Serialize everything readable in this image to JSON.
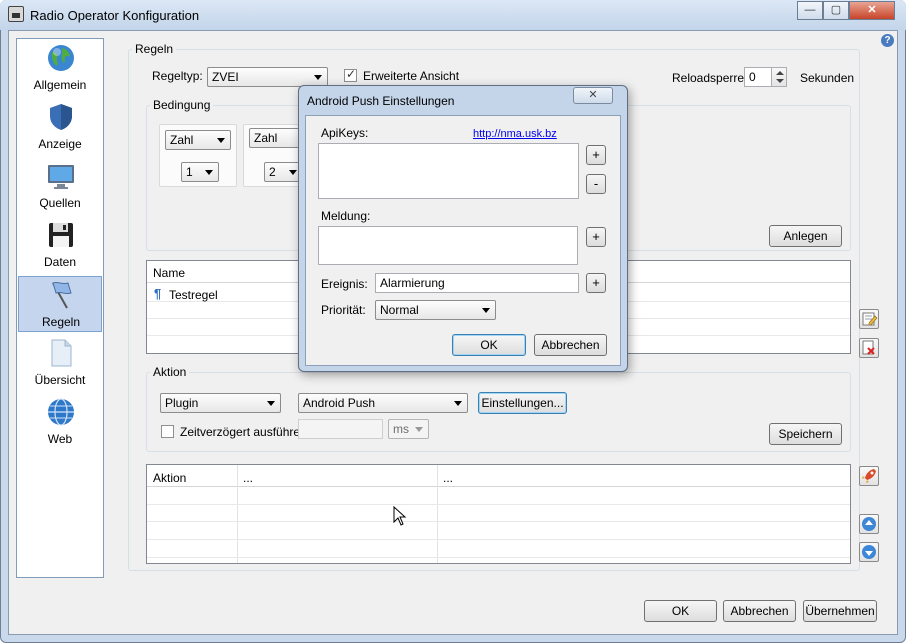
{
  "window": {
    "title": "Radio Operator Konfiguration",
    "min": "—",
    "max": "▢",
    "close": "✕"
  },
  "nav": [
    {
      "label": "Allgemein",
      "icon": "globe-icon"
    },
    {
      "label": "Anzeige",
      "icon": "shield-icon"
    },
    {
      "label": "Quellen",
      "icon": "monitor-icon"
    },
    {
      "label": "Daten",
      "icon": "floppy-disk-icon"
    },
    {
      "label": "Regeln",
      "icon": "flag-icon"
    },
    {
      "label": "Übersicht",
      "icon": "document-icon"
    },
    {
      "label": "Web",
      "icon": "globe-icon"
    }
  ],
  "regeln": {
    "group_label": "Regeln",
    "typ_label": "Regeltyp:",
    "typ_value": "ZVEI",
    "erweitert_label": "Erweiterte Ansicht",
    "erweitert_checked": true,
    "reload_label": "Reloadsperre:",
    "reload_value": "0",
    "reload_unit": "Sekunden"
  },
  "bedingung": {
    "group_label": "Bedingung",
    "cond1_type": "Zahl",
    "cond1_num": "1",
    "cond2_type": "Zahl",
    "cond2_num": "2",
    "anlegen": "Anlegen"
  },
  "rules_table": {
    "header": "Name",
    "rows": [
      "Testregel"
    ]
  },
  "aktion": {
    "group_label": "Aktion",
    "plugin_type": "Plugin",
    "plugin_value": "Android Push",
    "einstellungen": "Einstellungen...",
    "zeit_label": "Zeitverzögert ausführen",
    "unit": "ms",
    "speichern": "Speichern"
  },
  "action_table": {
    "headers": [
      "Aktion",
      "...",
      "..."
    ]
  },
  "footer": {
    "ok": "OK",
    "cancel": "Abbrechen",
    "apply": "Übernehmen"
  },
  "dialog": {
    "title": "Android Push Einstellungen",
    "close": "✕",
    "apikeys_label": "ApiKeys:",
    "link": "http://nma.usk.bz",
    "plus": "+",
    "minus": "-",
    "meldung_label": "Meldung:",
    "ereignis_label": "Ereignis:",
    "ereignis_value": "Alarmierung",
    "prioritaet_label": "Priorität:",
    "prioritaet_value": "Normal",
    "ok": "OK",
    "cancel": "Abbrechen"
  },
  "colors": {
    "selection": "#c5d5ee",
    "accent": "#3c7fb1",
    "link": "#0000ee"
  }
}
